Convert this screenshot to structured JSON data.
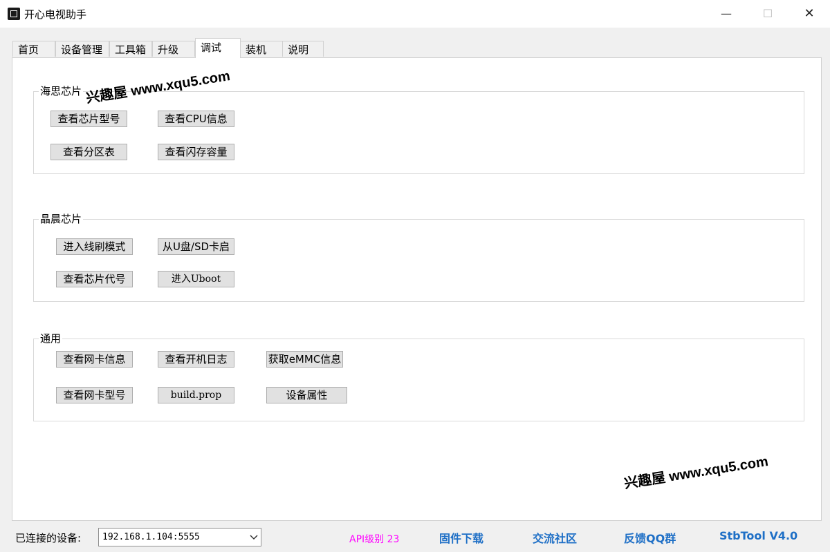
{
  "window": {
    "title": "开心电视助手",
    "controls": {
      "minimize": "—",
      "maximize": "☐",
      "close": "✕"
    }
  },
  "tabs": [
    {
      "label": "首页"
    },
    {
      "label": "设备管理"
    },
    {
      "label": "工具箱"
    },
    {
      "label": "升级"
    },
    {
      "label": "调试"
    },
    {
      "label": "装机"
    },
    {
      "label": "说明"
    }
  ],
  "active_tab": "调试",
  "groups": {
    "hisilicon": {
      "title": "海思芯片",
      "buttons": [
        "查看芯片型号",
        "查看CPU信息",
        "查看分区表",
        "查看闪存容量"
      ]
    },
    "amlogic": {
      "title": "晶晨芯片",
      "buttons": [
        "进入线刷模式",
        "从U盘/SD卡启",
        "查看芯片代号",
        "进入Uboot"
      ]
    },
    "general": {
      "title": "通用",
      "buttons": [
        "查看网卡信息",
        "查看开机日志",
        "获取eMMC信息",
        "查看网卡型号",
        "build.prop",
        "设备属性"
      ]
    }
  },
  "watermark": "兴趣屋 www.xqu5.com",
  "status": {
    "connected_label": "已连接的设备:",
    "device": "192.168.1.104:5555",
    "api_level": "API级别 23",
    "links": [
      "固件下载",
      "交流社区",
      "反馈QQ群",
      "StbTool V4.0"
    ]
  },
  "colors": {
    "api": "#ff00ff",
    "link": "#1e6fc6"
  }
}
